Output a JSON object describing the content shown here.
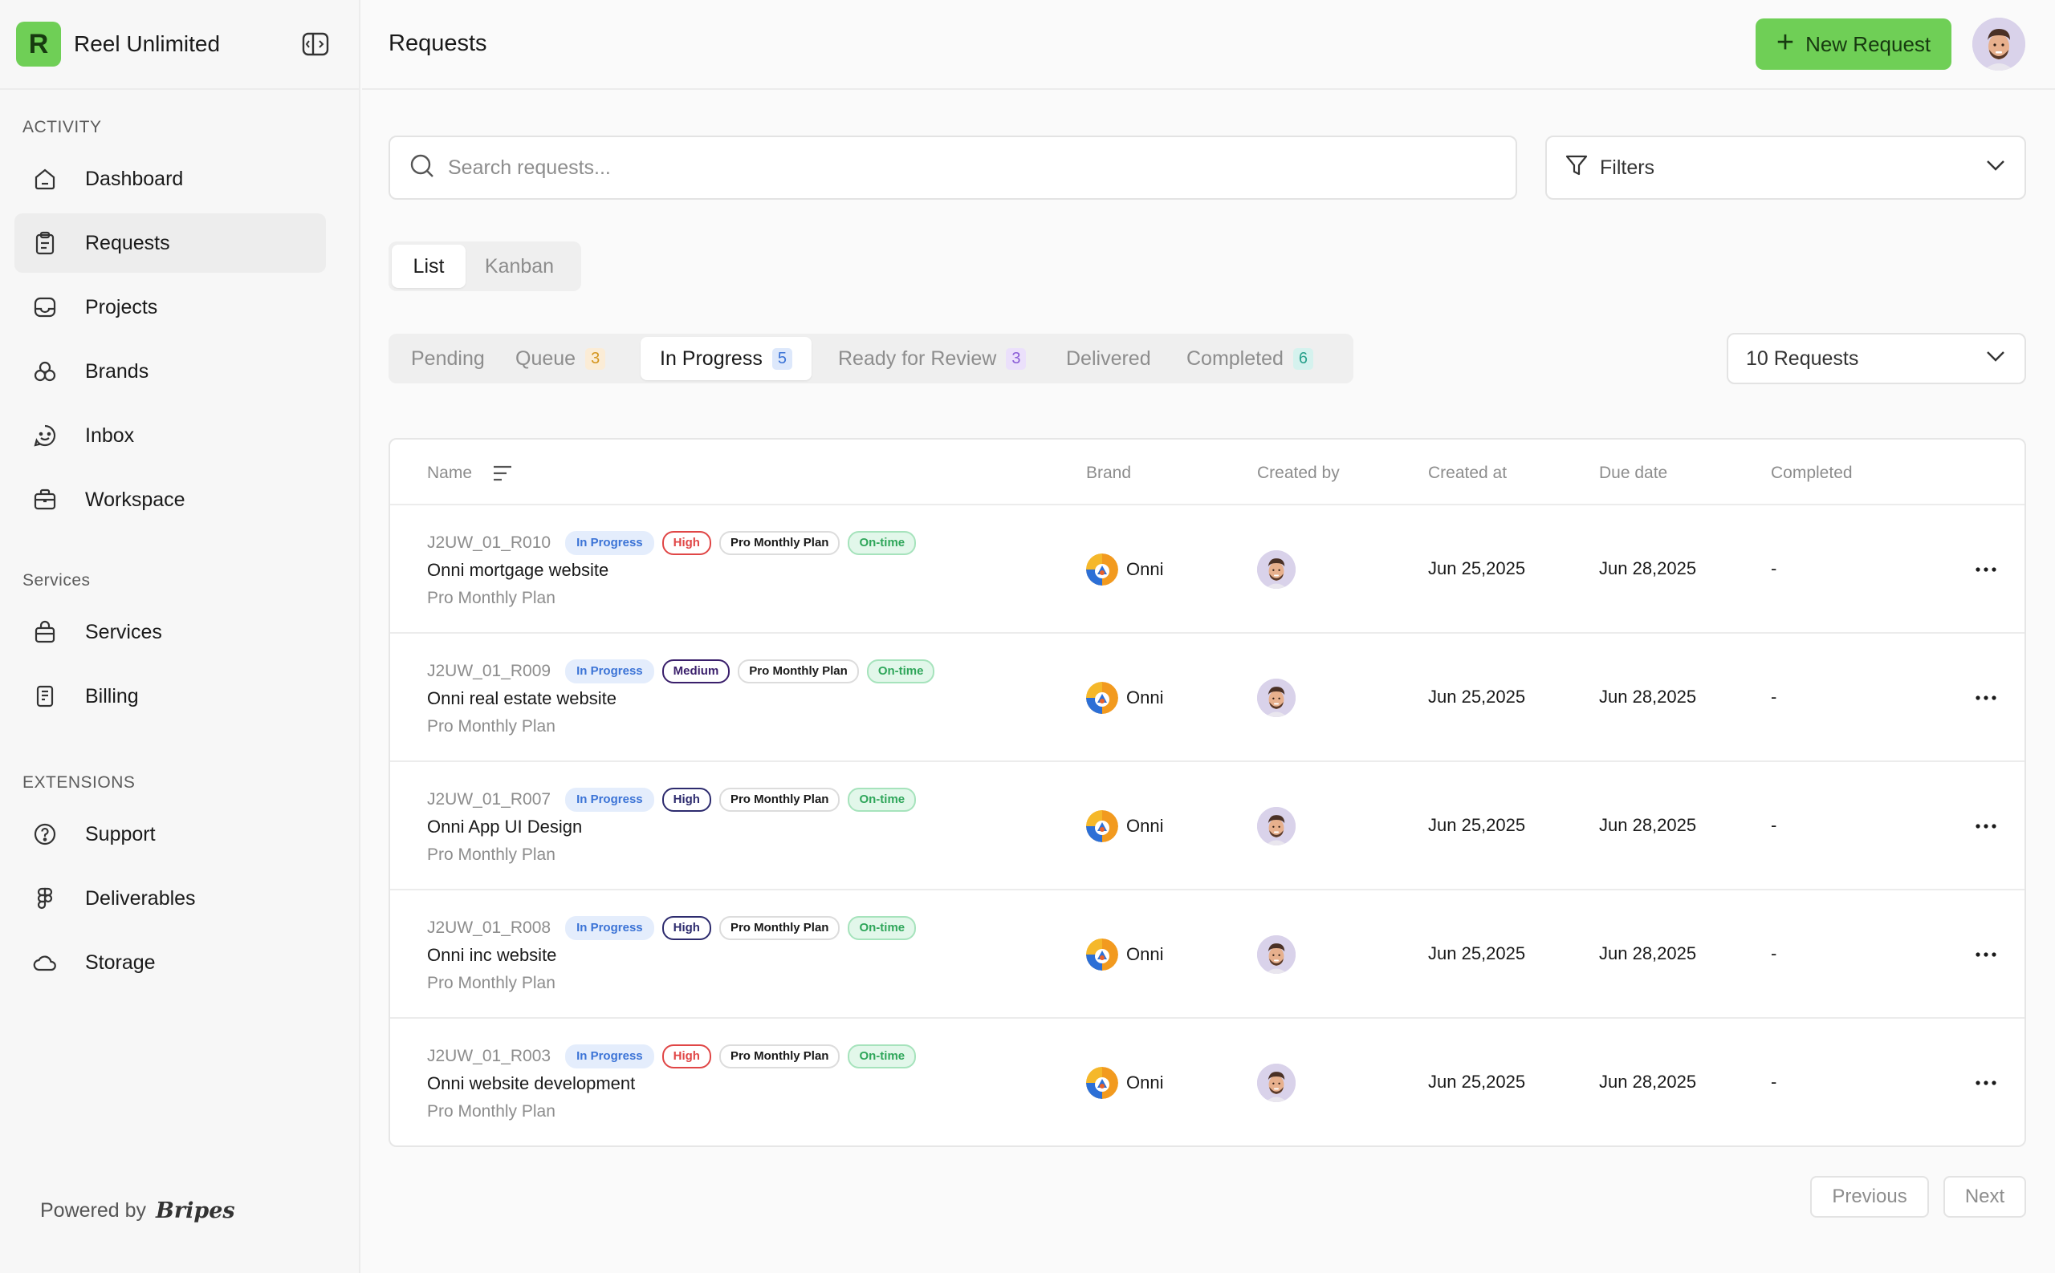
{
  "app": {
    "name": "Reel Unlimited",
    "logo_letter": "R",
    "brand_color": "#6fcf56"
  },
  "sidebar": {
    "sections": [
      {
        "title": "ACTIVITY",
        "items": [
          {
            "label": "Dashboard",
            "icon": "home-icon"
          },
          {
            "label": "Requests",
            "icon": "clipboard-icon",
            "active": true
          },
          {
            "label": "Projects",
            "icon": "inbox-tray-icon"
          },
          {
            "label": "Brands",
            "icon": "brands-icon"
          },
          {
            "label": "Inbox",
            "icon": "chat-icon"
          },
          {
            "label": "Workspace",
            "icon": "briefcase-icon"
          }
        ]
      },
      {
        "title": "Services",
        "items": [
          {
            "label": "Services",
            "icon": "shopping-bag-icon"
          },
          {
            "label": "Billing",
            "icon": "receipt-icon"
          }
        ]
      },
      {
        "title": "EXTENSIONS",
        "items": [
          {
            "label": "Support",
            "icon": "help-circle-icon"
          },
          {
            "label": "Deliverables",
            "icon": "figma-icon"
          },
          {
            "label": "Storage",
            "icon": "cloud-icon"
          }
        ]
      }
    ],
    "powered_by": "Powered by",
    "powered_brand": "Bripes"
  },
  "header": {
    "title": "Requests",
    "new_button": "New Request"
  },
  "search": {
    "placeholder": "Search requests...",
    "value": ""
  },
  "filters": {
    "label": "Filters"
  },
  "view_toggle": {
    "options": [
      "List",
      "Kanban"
    ],
    "selected": "List"
  },
  "status_tabs": [
    {
      "label": "Pending",
      "count": null
    },
    {
      "label": "Queue",
      "count": "3",
      "color": "orange"
    },
    {
      "label": "In Progress",
      "count": "5",
      "color": "blue",
      "active": true
    },
    {
      "label": "Ready for Review",
      "count": "3",
      "color": "purple"
    },
    {
      "label": "Delivered",
      "count": null
    },
    {
      "label": "Completed",
      "count": "6",
      "color": "teal"
    }
  ],
  "per_page": {
    "label": "10 Requests"
  },
  "table": {
    "columns": [
      "Name",
      "Brand",
      "Created by",
      "Created at",
      "Due date",
      "Completed"
    ],
    "rows": [
      {
        "id": "J2UW_01_R010",
        "status": "In Progress",
        "priority": "High",
        "priority_style": "high-red",
        "plan_tag": "Pro Monthly Plan",
        "timing": "On-time",
        "title": "Onni mortgage website",
        "plan": "Pro Monthly Plan",
        "brand": "Onni",
        "created_at": "Jun 25,2025",
        "due_date": "Jun 28,2025",
        "completed": "-"
      },
      {
        "id": "J2UW_01_R009",
        "status": "In Progress",
        "priority": "Medium",
        "priority_style": "medium",
        "plan_tag": "Pro Monthly Plan",
        "timing": "On-time",
        "title": "Onni real estate website",
        "plan": "Pro Monthly Plan",
        "brand": "Onni",
        "created_at": "Jun 25,2025",
        "due_date": "Jun 28,2025",
        "completed": "-"
      },
      {
        "id": "J2UW_01_R007",
        "status": "In Progress",
        "priority": "High",
        "priority_style": "high-navy",
        "plan_tag": "Pro Monthly Plan",
        "timing": "On-time",
        "title": "Onni App UI Design",
        "plan": "Pro Monthly Plan",
        "brand": "Onni",
        "created_at": "Jun 25,2025",
        "due_date": "Jun 28,2025",
        "completed": "-"
      },
      {
        "id": "J2UW_01_R008",
        "status": "In Progress",
        "priority": "High",
        "priority_style": "high-navy",
        "plan_tag": "Pro Monthly Plan",
        "timing": "On-time",
        "title": "Onni inc website",
        "plan": "Pro Monthly Plan",
        "brand": "Onni",
        "created_at": "Jun 25,2025",
        "due_date": "Jun 28,2025",
        "completed": "-"
      },
      {
        "id": "J2UW_01_R003",
        "status": "In Progress",
        "priority": "High",
        "priority_style": "high-red",
        "plan_tag": "Pro Monthly Plan",
        "timing": "On-time",
        "title": "Onni website development",
        "plan": "Pro Monthly Plan",
        "brand": "Onni",
        "created_at": "Jun 25,2025",
        "due_date": "Jun 28,2025",
        "completed": "-"
      }
    ]
  },
  "pagination": {
    "previous": "Previous",
    "next": "Next"
  }
}
